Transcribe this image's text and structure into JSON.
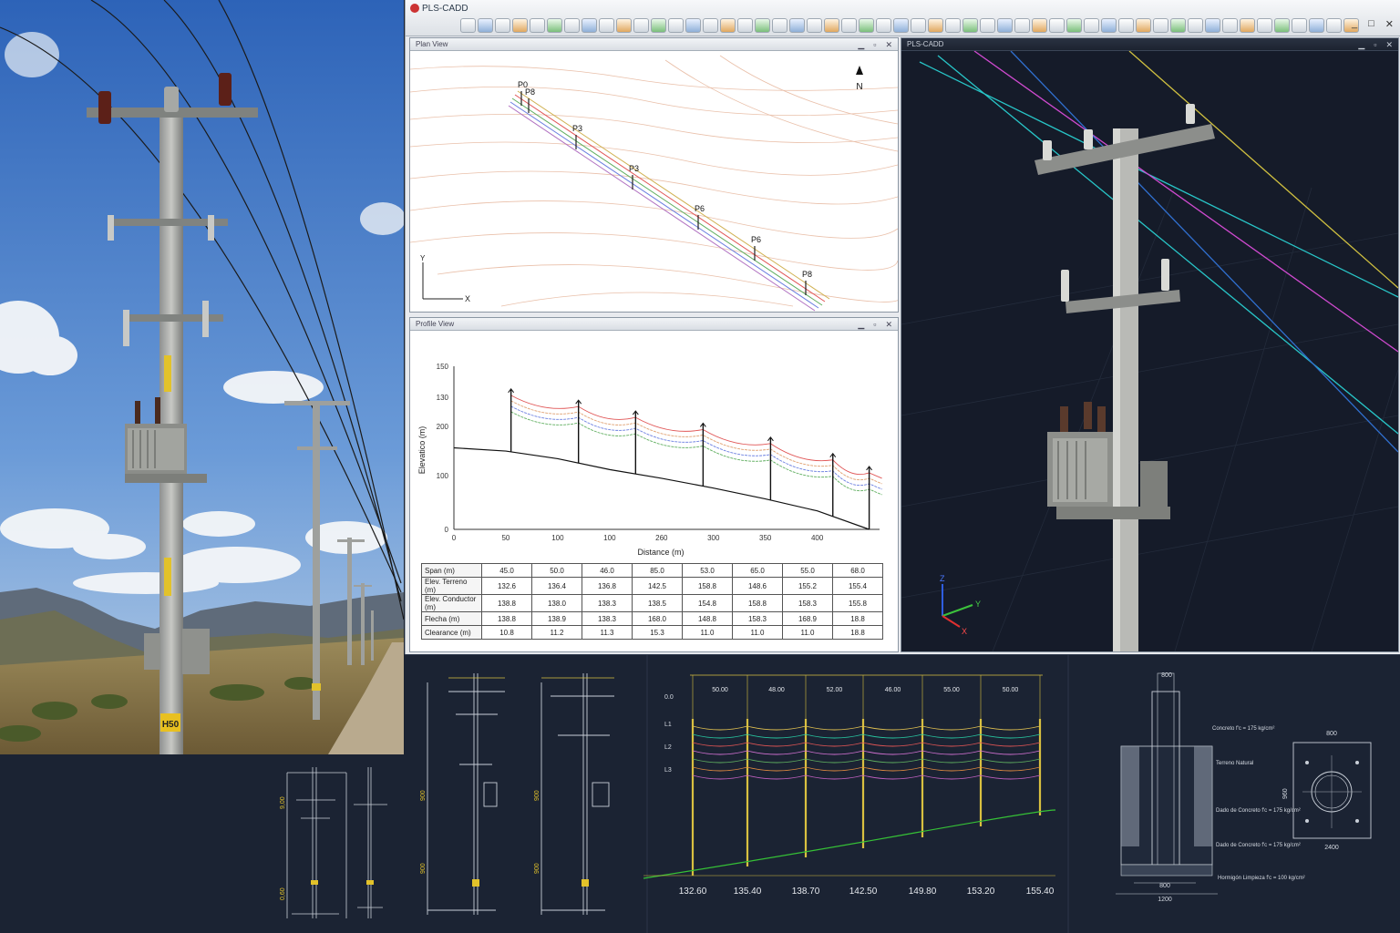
{
  "app": {
    "title": "PLS-CADD",
    "window_controls": [
      "_",
      "□",
      "✕"
    ]
  },
  "plan_view": {
    "title": "Plan View",
    "north_label": "N",
    "axis_x": "X",
    "axis_y": "Y",
    "pole_labels": [
      "P0",
      "P8",
      "P3",
      "P3",
      "P6",
      "P6",
      "P8"
    ]
  },
  "profile_view": {
    "title": "Profile View",
    "ylabel": "Elevatico (m)",
    "xlabel": "Distance (m)",
    "y_ticks": [
      "150",
      "130",
      "200",
      "100",
      "0"
    ],
    "x_ticks": [
      "0",
      "50",
      "100",
      "100",
      "260",
      "300",
      "350",
      "400"
    ]
  },
  "chart_data": {
    "type": "line",
    "title": "",
    "xlabel": "Distance (m)",
    "ylabel": "Elevatico (m)",
    "xlim": [
      0,
      410
    ],
    "ylim": [
      0,
      150
    ],
    "grid": false,
    "ground": {
      "x": [
        0,
        50,
        100,
        150,
        200,
        250,
        300,
        350,
        400
      ],
      "y": [
        75,
        72,
        65,
        55,
        47,
        38,
        28,
        17,
        0
      ]
    },
    "poles_x": [
      55,
      120,
      175,
      240,
      305,
      365,
      425
    ],
    "series": [
      {
        "color": "#e05555",
        "offset": 0
      },
      {
        "color": "#e0a070",
        "offset": 6
      },
      {
        "color": "#6a7ee0",
        "offset": 12
      },
      {
        "color": "#5fae5f",
        "offset": 18
      }
    ]
  },
  "span_table": {
    "rows": [
      {
        "label": "Span (m)",
        "values": [
          "45.0",
          "50.0",
          "46.0",
          "85.0",
          "53.0",
          "65.0",
          "55.0",
          "68.0"
        ]
      },
      {
        "label": "Elev. Terreno (m)",
        "values": [
          "132.6",
          "136.4",
          "136.8",
          "142.5",
          "158.8",
          "148.6",
          "155.2",
          "155.4"
        ]
      },
      {
        "label": "Elev. Conductor (m)",
        "values": [
          "138.8",
          "138.0",
          "138.3",
          "138.5",
          "154.8",
          "158.8",
          "158.3",
          "155.8"
        ]
      },
      {
        "label": "Flecha (m)",
        "values": [
          "138.8",
          "138.9",
          "138.3",
          "168.0",
          "148.8",
          "158.3",
          "168.9",
          "18.8"
        ]
      },
      {
        "label": "Clearance (m)",
        "values": [
          "10.8",
          "11.2",
          "11.3",
          "15.3",
          "11.0",
          "11.0",
          "11.0",
          "18.8"
        ]
      }
    ]
  },
  "view3d": {
    "title": "PLS-CADD",
    "axis_z": "Z",
    "axis_y": "Y",
    "axis_x": "X"
  },
  "cad_profile": {
    "span_labels": [
      "50.00",
      "48.00",
      "52.00",
      "46.00",
      "55.00",
      "50.00"
    ],
    "line_labels": [
      "L1",
      "L2",
      "L3"
    ],
    "elev_labels": [
      "132.60",
      "135.40",
      "138.70",
      "142.50",
      "149.80",
      "153.20",
      "155.40"
    ],
    "phase_label": "0.0"
  },
  "cad_foundation": {
    "top_dim": "800",
    "bottom_dim_inner": "800",
    "bottom_dim_outer": "1200",
    "notes": [
      "Concreto f'c = 175 kg/cm²",
      "Terreno Natural",
      "Dado de Concreto f'c = 175 kg/cm²",
      "Dado de Concreto f'c = 175 kg/cm²",
      "Hormigón Limpieza f'c = 100 kg/cm²"
    ],
    "plan_top_dim": "800",
    "plan_bottom_dim": "2400",
    "side_dim": "960"
  },
  "cad_elevations": {
    "dims_left": [
      "900",
      "900"
    ],
    "dims_right": [
      "900",
      "900"
    ]
  },
  "photo": {
    "sign_text": "H50"
  }
}
